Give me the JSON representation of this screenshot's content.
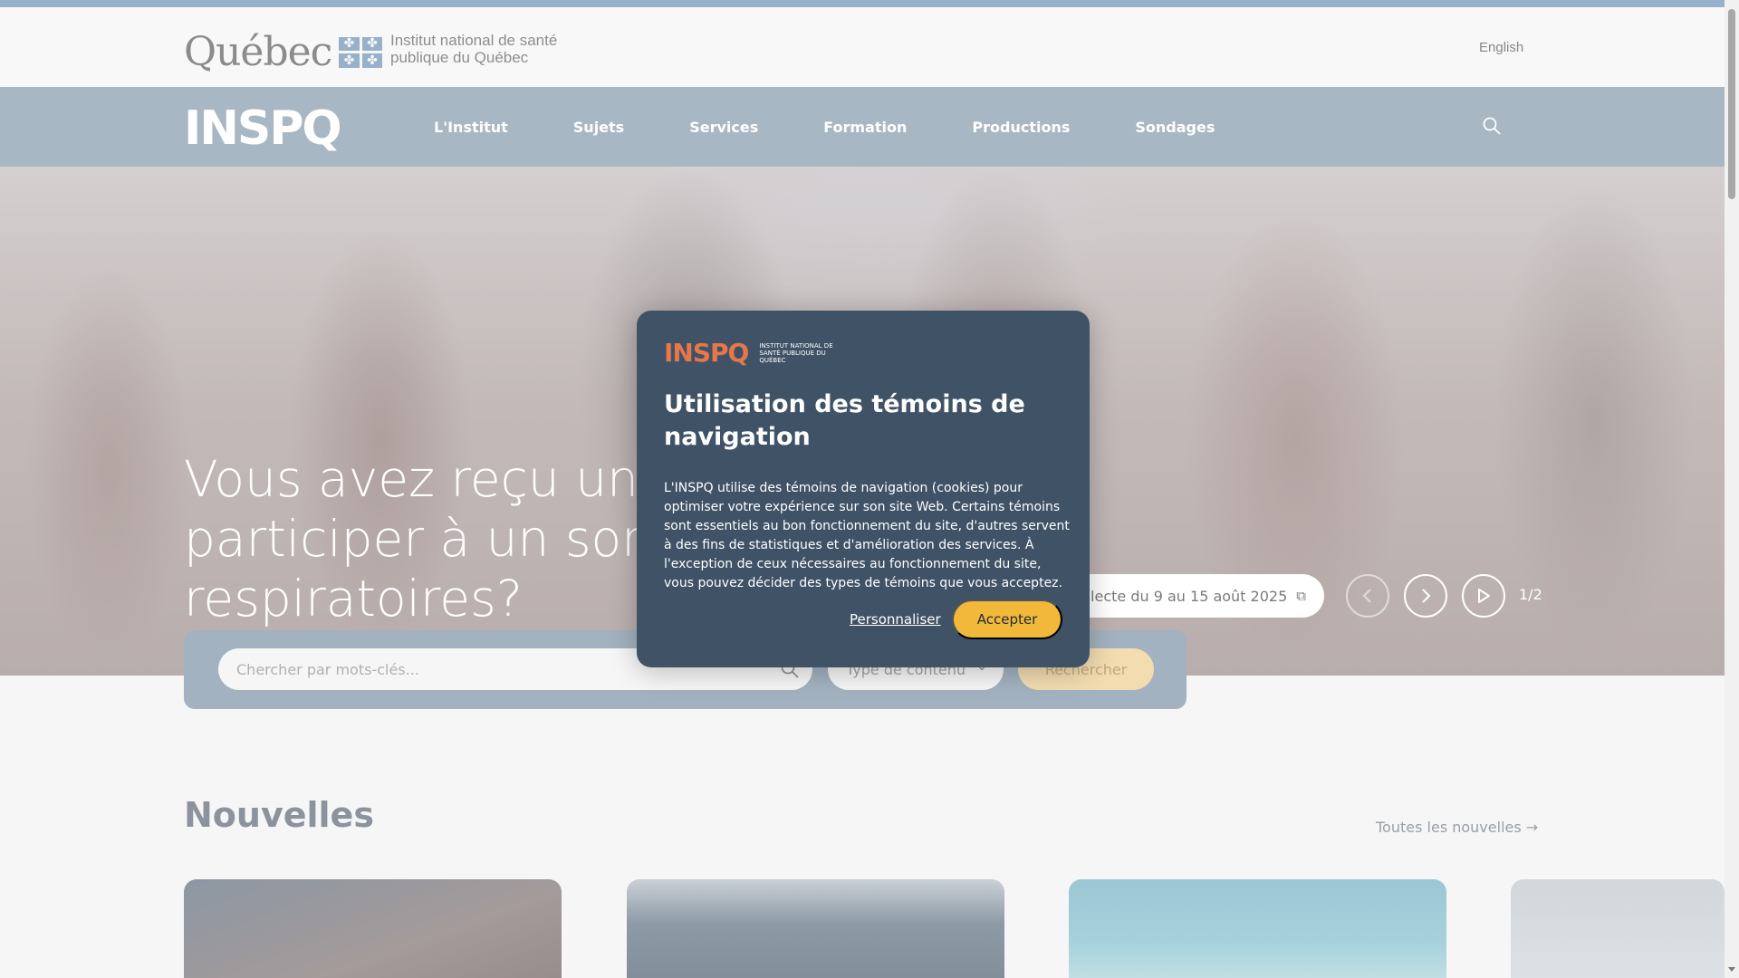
{
  "gov_header": {
    "logo_word": "Québec",
    "institution": "Institut national de santé publique du Québec",
    "language_link": "English"
  },
  "nav": {
    "logo": "INSPQ",
    "items": [
      {
        "label": "L'Institut"
      },
      {
        "label": "Sujets"
      },
      {
        "label": "Services"
      },
      {
        "label": "Formation"
      },
      {
        "label": "Productions"
      },
      {
        "label": "Sondages"
      }
    ],
    "search_icon": "search-icon"
  },
  "hero": {
    "title": "Vous avez reçu une invitation à participer à un sondage sur les virus respiratoires?",
    "pill_text": "Collecte du 9 au 15 août 2025",
    "pill_icon": "external-link-icon",
    "slide_counter": "1/2",
    "controls": {
      "prev": "chevron-left-icon",
      "next": "chevron-right-icon",
      "play": "play-icon"
    }
  },
  "search": {
    "placeholder": "Chercher par mots-clés...",
    "type_select": "Type de contenu",
    "button": "Rechercher"
  },
  "news": {
    "title": "Nouvelles",
    "all_link": "Toutes les nouvelles"
  },
  "cookie_modal": {
    "logo": "INSPQ",
    "logo_sub": "INSTITUT NATIONAL DE SANTÉ PUBLIQUE DU QUÉBEC",
    "title": "Utilisation des témoins de navigation",
    "body": "L'INSPQ utilise des témoins de navigation (cookies) pour optimiser votre expérience sur son site Web. Certains témoins sont essentiels au bon fonctionnement du site, d'autres servent à des fins de statistiques et d'amélioration des services. À l'exception de ceux nécessaires au fonctionnement du site, vous pouvez décider des types de témoins que vous acceptez.",
    "customize": "Personnaliser",
    "accept": "Accepter"
  },
  "colors": {
    "nav_bg": "#8fa4b4",
    "modal_bg": "#3f5266",
    "accept_btn": "#f2b83a",
    "brand_orange": "#e5774a"
  }
}
